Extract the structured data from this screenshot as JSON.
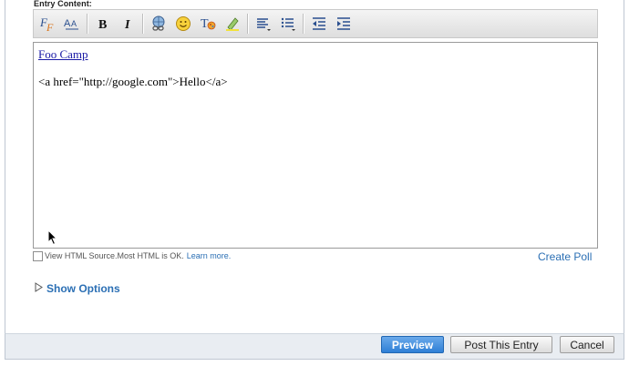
{
  "entry": {
    "label": "Entry Content:"
  },
  "toolbar": {
    "buttons": [
      {
        "name": "font-face-icon"
      },
      {
        "name": "font-size-icon"
      },
      {
        "name": "bold-icon",
        "glyph": "B"
      },
      {
        "name": "italic-icon",
        "glyph": "I"
      },
      {
        "name": "insert-link-icon"
      },
      {
        "name": "emoticon-icon"
      },
      {
        "name": "text-color-icon"
      },
      {
        "name": "highlight-icon"
      },
      {
        "name": "align-icon"
      },
      {
        "name": "bulleted-list-icon"
      },
      {
        "name": "outdent-icon"
      },
      {
        "name": "indent-icon"
      }
    ]
  },
  "editor": {
    "link_text": "Foo Camp",
    "raw_html_text": "<a href=\"http://google.com\">Hello</a>"
  },
  "html_source": {
    "checkbox_label": "View HTML Source.",
    "hint": "Most HTML is OK.",
    "learn_more": "Learn more."
  },
  "create_poll": "Create Poll",
  "show_options": "Show Options",
  "buttons": {
    "preview": "Preview",
    "post": "Post This Entry",
    "cancel": "Cancel"
  },
  "colors": {
    "link": "#2b6fb4",
    "primary_button": "#2e7fd6"
  }
}
